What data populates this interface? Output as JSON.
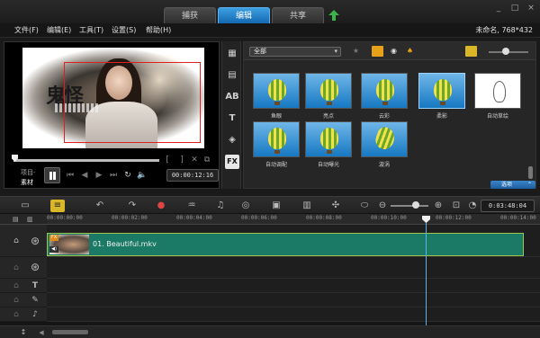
{
  "tabs": [
    {
      "label": "捕获"
    },
    {
      "label": "编辑"
    },
    {
      "label": "共享"
    }
  ],
  "window_controls": {
    "minimize": "_",
    "maximize": "□",
    "close": "×"
  },
  "menu": {
    "items": [
      "文件(F)",
      "编辑(E)",
      "工具(T)",
      "设置(S)",
      "帮助(H)"
    ],
    "project_info": "未命名, 768*432"
  },
  "preview": {
    "video_text": "鬼怪",
    "mode_project": "项目-",
    "mode_clip": "素材",
    "timecode": "00:00:12:16",
    "brackets": [
      "[",
      "]"
    ],
    "play_progress": 0.03
  },
  "library": {
    "filter": "全部",
    "thumb_slider_value": 0.45,
    "effects": [
      {
        "label": "鱼眼",
        "style": "balloon"
      },
      {
        "label": "亮点",
        "style": "balloon"
      },
      {
        "label": "云彩",
        "style": "balloon"
      },
      {
        "label": "柔影",
        "style": "balloon"
      },
      {
        "label": "自动草绘",
        "style": "sketch"
      },
      {
        "label": "自动调配",
        "style": "balloon"
      },
      {
        "label": "自动曝光",
        "style": "balloon"
      },
      {
        "label": "漩涡",
        "style": "balloon"
      }
    ],
    "options_label": "选项"
  },
  "timeline": {
    "duration": "0:03:48:04",
    "ruler": [
      "00:00:00:00",
      "00:00:02:00",
      "00:00:04:00",
      "00:00:06:00",
      "00:00:08:00",
      "00:00:10:00",
      "00:00:12:00",
      "00:00:14:00"
    ],
    "clip": {
      "name": "01. Beautiful.mkv",
      "fx_badge": "FX",
      "audio_badge": "◀)"
    },
    "playhead_time_fraction": 0.77
  },
  "colors": {
    "accent": "#1e75c2",
    "clip": "#1a7a66",
    "clip_border": "#9dc44d",
    "playhead": "#5ab0ee",
    "selection": "#e02020"
  }
}
